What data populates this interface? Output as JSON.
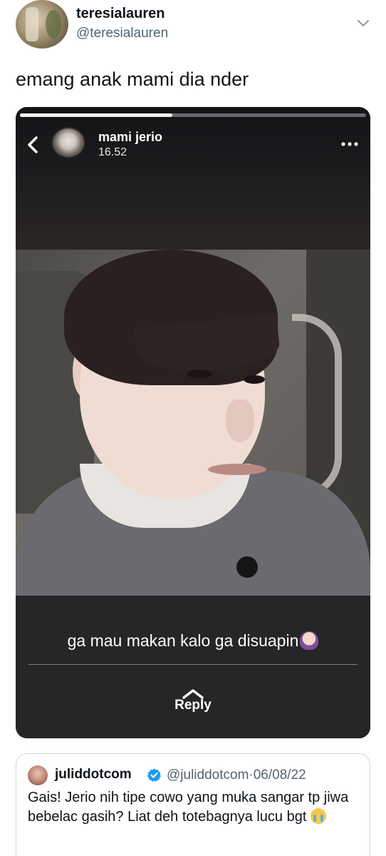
{
  "tweet": {
    "display_name": "teresialauren",
    "handle": "@teresialauren",
    "text": "emang anak mami dia nder"
  },
  "story": {
    "progress": 0.44,
    "account_name": "mami jerio",
    "time": "16.52",
    "caption": "ga mau makan kalo ga disuapin",
    "caption_emoji": "person-facepalming-emoji",
    "reply_label": "Reply"
  },
  "quoted_tweet": {
    "display_name": "juliddotcom",
    "handle": "@juliddotcom",
    "separator": "·",
    "date": "06/08/22",
    "text": "Gais! Jerio nih tipe cowo yang muka sangar tp jiwa bebelac gasih? Liat deh totebagnya lucu bgt",
    "emoji": "loudly-crying-face-emoji"
  },
  "colors": {
    "verified_blue": "#1d9bf0",
    "secondary_text": "#536471"
  }
}
